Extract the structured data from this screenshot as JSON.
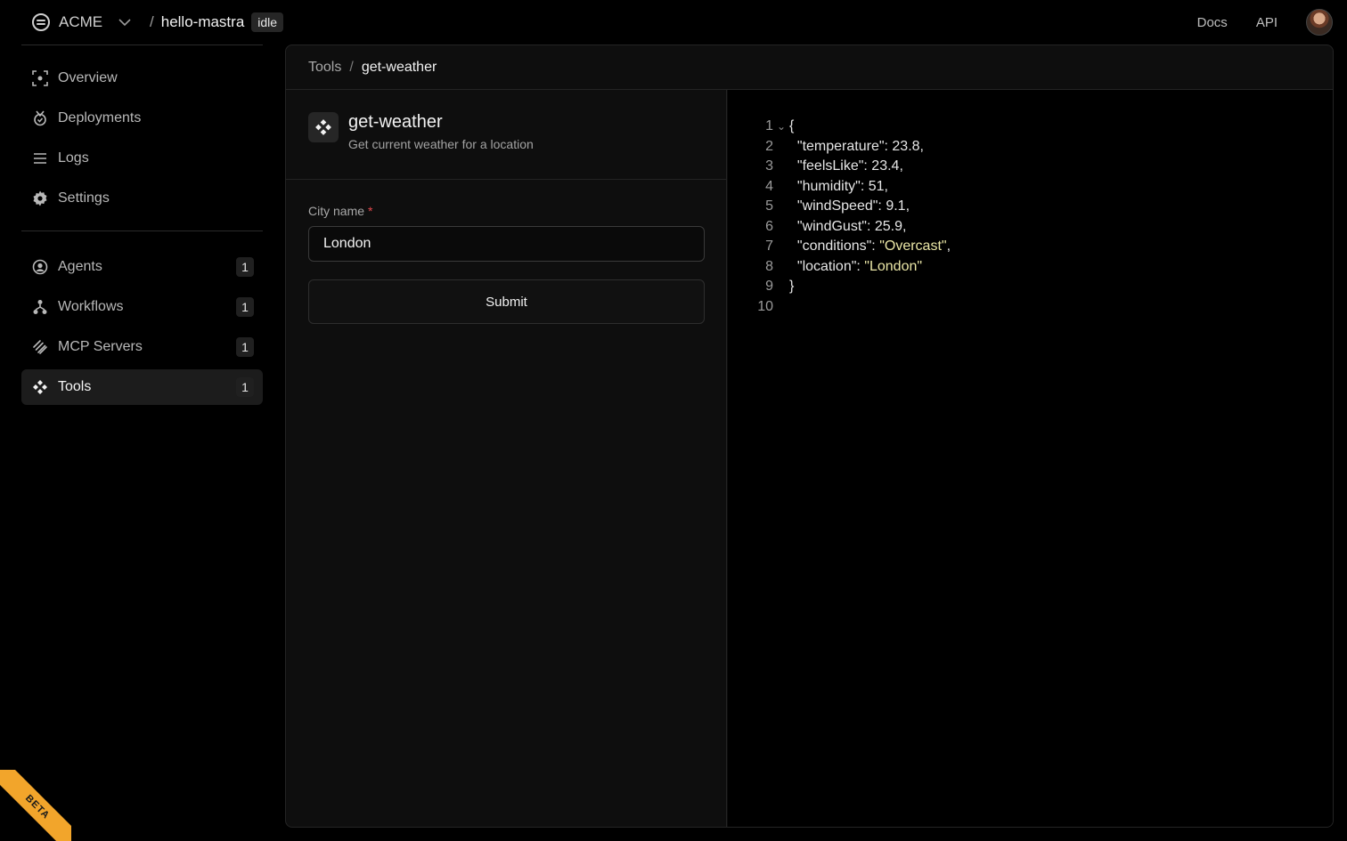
{
  "topbar": {
    "org_name": "ACME",
    "project_name": "hello-mastra",
    "project_separator": "/",
    "status": "idle",
    "links": {
      "docs": "Docs",
      "api": "API"
    }
  },
  "sidebar": {
    "primary": [
      {
        "label": "Overview",
        "icon": "overview-icon"
      },
      {
        "label": "Deployments",
        "icon": "deployments-icon"
      },
      {
        "label": "Logs",
        "icon": "logs-icon"
      },
      {
        "label": "Settings",
        "icon": "gear-icon"
      }
    ],
    "secondary": [
      {
        "label": "Agents",
        "count": "1",
        "icon": "agent-icon"
      },
      {
        "label": "Workflows",
        "count": "1",
        "icon": "workflow-icon"
      },
      {
        "label": "MCP Servers",
        "count": "1",
        "icon": "mcp-icon"
      },
      {
        "label": "Tools",
        "count": "1",
        "icon": "tools-icon",
        "active": true
      }
    ]
  },
  "breadcrumb": {
    "root": "Tools",
    "separator": "/",
    "current": "get-weather"
  },
  "tool": {
    "name": "get-weather",
    "description": "Get current weather for a location",
    "form": {
      "field_label": "City name",
      "required_marker": "*",
      "field_value": "London",
      "submit_label": "Submit"
    }
  },
  "result": {
    "lines": [
      {
        "n": "1",
        "text": "{",
        "fold": "⌄"
      },
      {
        "n": "2",
        "key": "  \"temperature\": ",
        "value": "23.8",
        "tail": ","
      },
      {
        "n": "3",
        "key": "  \"feelsLike\": ",
        "value": "23.4",
        "tail": ","
      },
      {
        "n": "4",
        "key": "  \"humidity\": ",
        "value": "51",
        "tail": ","
      },
      {
        "n": "5",
        "key": "  \"windSpeed\": ",
        "value": "9.1",
        "tail": ","
      },
      {
        "n": "6",
        "key": "  \"windGust\": ",
        "value": "25.9",
        "tail": ","
      },
      {
        "n": "7",
        "key": "  \"conditions\": ",
        "string": "\"Overcast\"",
        "tail": ","
      },
      {
        "n": "8",
        "key": "  \"location\": ",
        "string": "\"London\"",
        "tail": ""
      },
      {
        "n": "9",
        "text": "}"
      },
      {
        "n": "10",
        "text": ""
      }
    ]
  },
  "beta_label": "BETA",
  "colors": {
    "background": "#000000",
    "panel": "#0e0e0e",
    "string": "#eae6a6",
    "required": "#e5484d",
    "beta": "#f2a52b"
  }
}
